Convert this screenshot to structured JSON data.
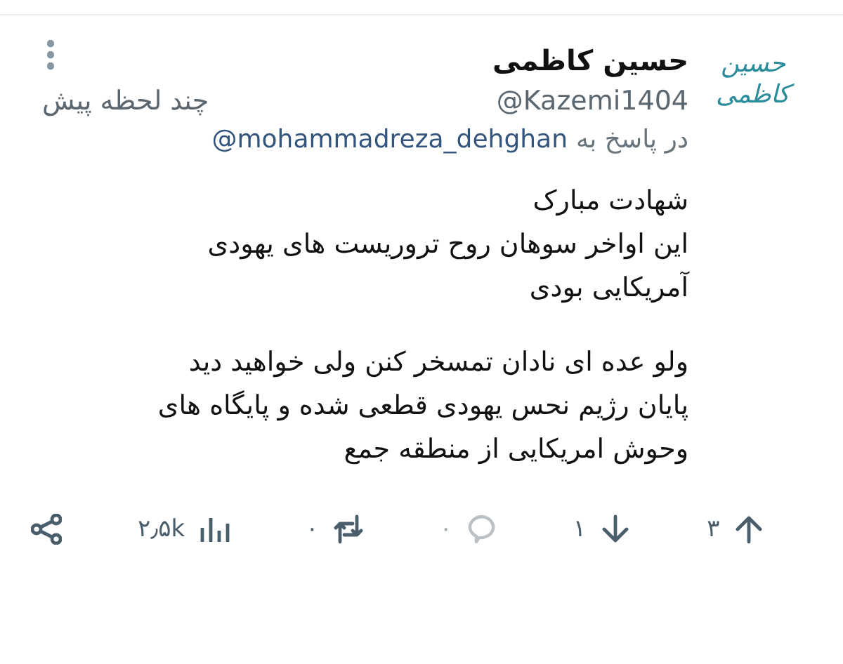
{
  "tweet": {
    "avatar_text": "حسین کاظمی",
    "name": "حسین کاظمی",
    "handle": "@Kazemi1404",
    "time": "چند لحظه پیش",
    "reply_to": {
      "prefix": "در پاسخ به",
      "user": "@mohammadreza_dehghan"
    },
    "paragraphs": [
      [
        "شهادت مبارک",
        "این اواخر سوهان روح تروریست های یهودی",
        "آمریکایی بودی"
      ],
      [
        "ولو عده ای نادان تمسخر کنن ولی خواهید دید",
        "پایان رژیم نحس یهودی قطعی شده و پایگاه های",
        "وحوش امریکایی از منطقه جمع"
      ]
    ],
    "actions": [
      {
        "kind": "upvote",
        "count": "۳",
        "disabled": false
      },
      {
        "kind": "downvote",
        "count": "۱",
        "disabled": false
      },
      {
        "kind": "reply",
        "count": "۰",
        "disabled": true
      },
      {
        "kind": "retweet",
        "count": "۰",
        "disabled": false
      },
      {
        "kind": "views",
        "count": "۲٫۵k",
        "disabled": false
      },
      {
        "kind": "share",
        "disabled": false
      }
    ]
  }
}
